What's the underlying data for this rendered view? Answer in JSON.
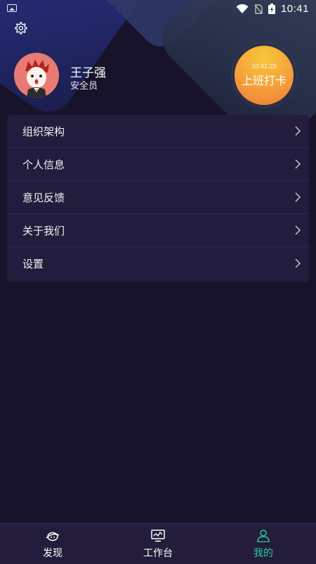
{
  "status_bar": {
    "time": "10:41",
    "icons": [
      "image-icon",
      "wifi-icon",
      "no-sim-icon",
      "battery-charging-icon"
    ]
  },
  "header": {
    "settings_icon": "gear-icon"
  },
  "profile": {
    "name": "王子强",
    "role": "安全员",
    "avatar_icon": "cartoon-boy-avatar"
  },
  "punch_button": {
    "time": "10:41:23",
    "label": "上班打卡"
  },
  "menu": {
    "items": [
      {
        "label": "组织架构"
      },
      {
        "label": "个人信息"
      },
      {
        "label": "意见反馈"
      },
      {
        "label": "关于我们"
      },
      {
        "label": "设置"
      }
    ]
  },
  "bottom_nav": {
    "items": [
      {
        "label": "发现",
        "icon": "planet-icon",
        "active": false
      },
      {
        "label": "工作台",
        "icon": "monitor-chart-icon",
        "active": false
      },
      {
        "label": "我的",
        "icon": "person-icon",
        "active": true
      }
    ]
  },
  "colors": {
    "background": "#17132a",
    "card": "#221d3c",
    "accent_active": "#27c6a0",
    "punch_orange": "#f6a83b"
  }
}
